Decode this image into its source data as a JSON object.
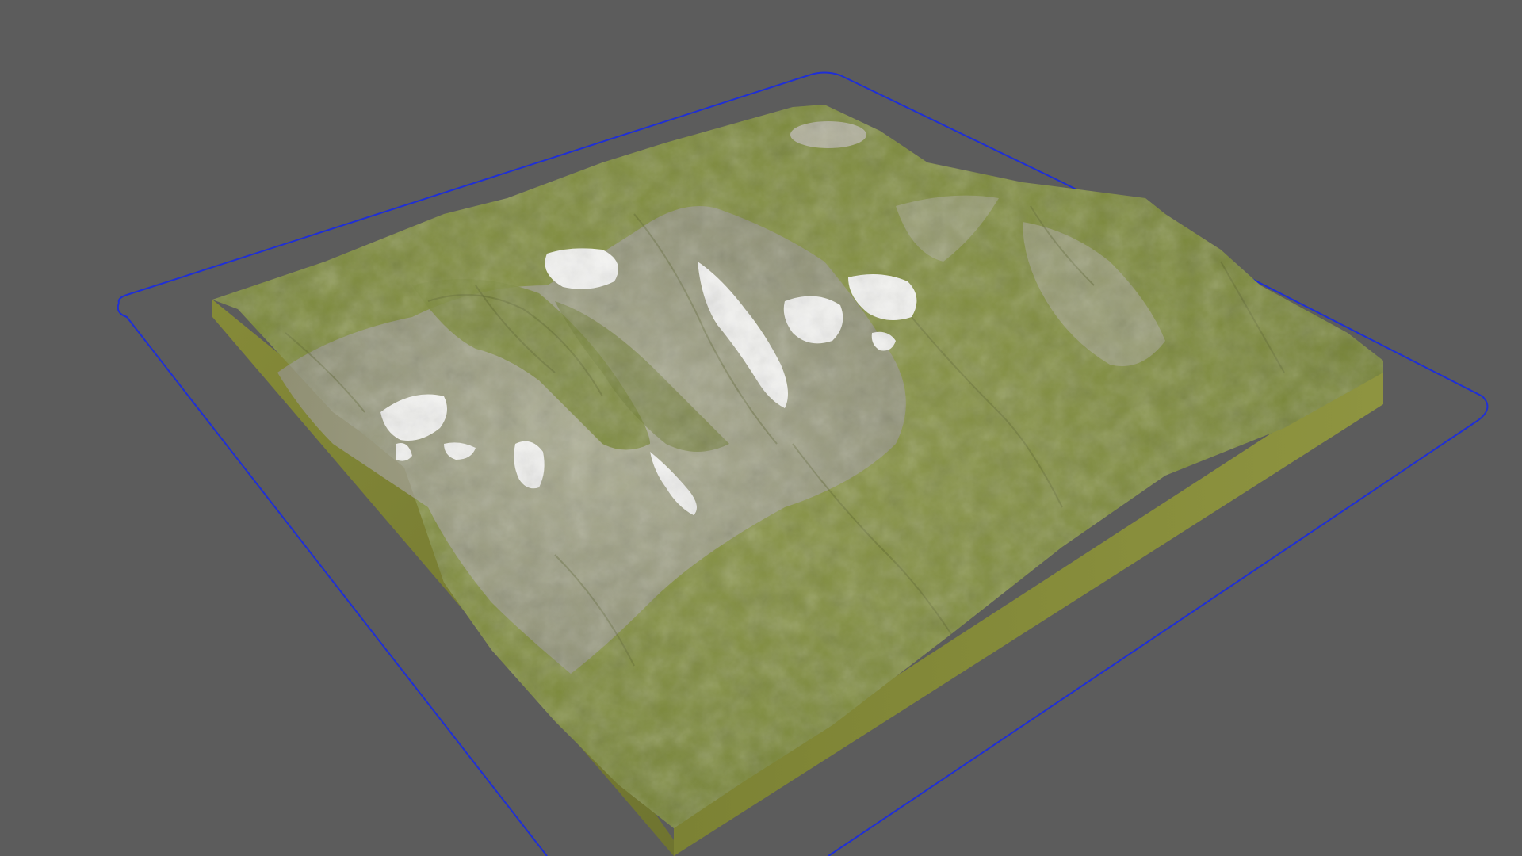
{
  "viewport": {
    "background": "#5c5c5c",
    "selection_outline_color": "#1f2fd6"
  },
  "terrain": {
    "grass_color": "#7e8c3d",
    "grass_dark_color": "#66732d",
    "rock_color": "#a7a59a",
    "snow_color": "#f2f2f0",
    "base_side_color": "#8a8e3a",
    "base_side_dark_color": "#73772f"
  }
}
